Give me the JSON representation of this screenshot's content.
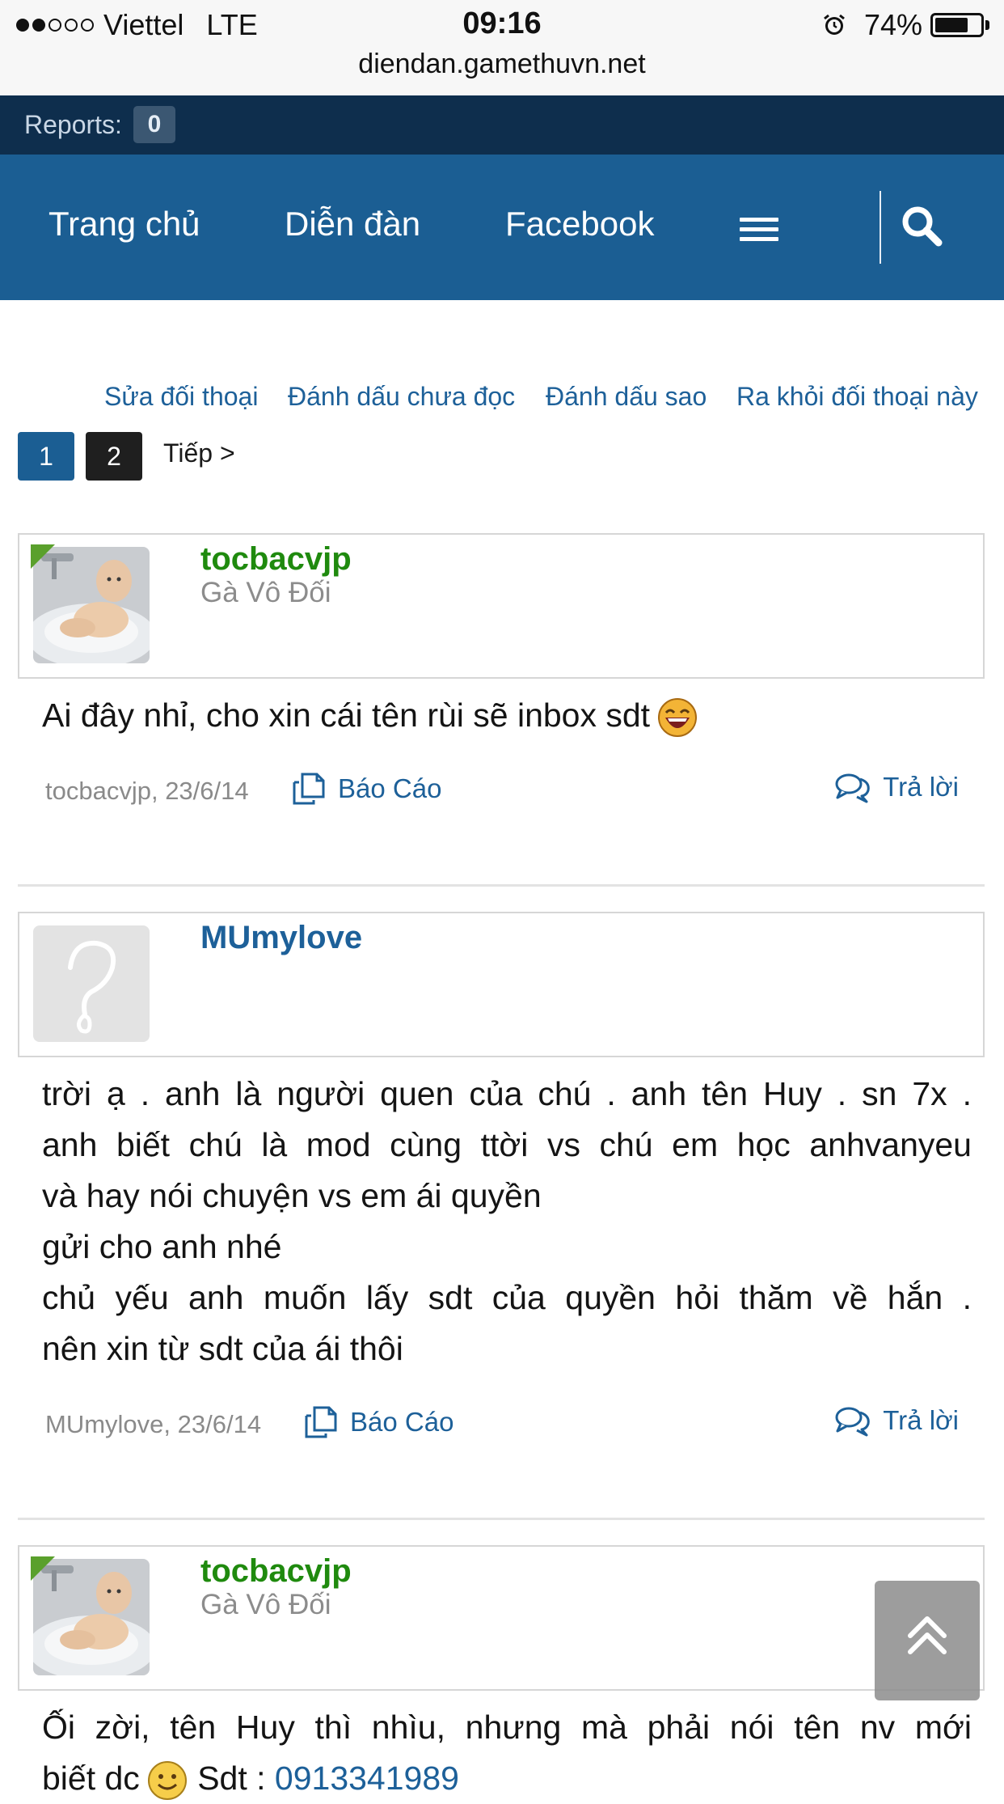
{
  "status_bar": {
    "carrier": "Viettel",
    "network": "LTE",
    "time": "09:16",
    "battery": "74%",
    "battery_level": 0.74,
    "url": "diendan.gamethuvn.net"
  },
  "reports": {
    "label": "Reports:",
    "count": "0"
  },
  "nav": {
    "items": [
      "Trang chủ",
      "Diễn đàn",
      "Facebook"
    ],
    "menu_icon": "hamburger-icon",
    "search_icon": "search-icon"
  },
  "actions": [
    "Sửa đối thoại",
    "Đánh dấu chưa đọc",
    "Đánh dấu sao",
    "Ra khỏi đối thoại này"
  ],
  "pagination": {
    "pages": [
      "1",
      "2"
    ],
    "current": "1",
    "next": "Tiếp >"
  },
  "posts": [
    {
      "username": "tocbacvjp",
      "user_title": "Gà Vô Đối",
      "online": true,
      "message_lines": [
        "Ai đây nhỉ, cho xin cái tên rùi sẽ inbox sdt"
      ],
      "smiley": "laughing-smiley-icon",
      "meta": "tocbacvjp, 23/6/14",
      "report": "Báo Cáo",
      "reply": "Trả lời"
    },
    {
      "username": "MUmylove",
      "user_title": "",
      "online": false,
      "message_lines": [
        "trời ạ . anh là người quen của chú . anh tên Huy . sn 7x .",
        "anh biết chú là mod cùng ttời vs chú em học anhvanyeu",
        "và hay nói chuyện vs em ái quyền",
        "gửi cho anh nhé",
        "chủ yếu anh muốn lấy sdt của quyền hỏi thăm về hắn .",
        "nên xin từ sdt của ái thôi"
      ],
      "meta": "MUmylove, 23/6/14",
      "report": "Báo Cáo",
      "reply": "Trả lời"
    },
    {
      "username": "tocbacvjp",
      "user_title": "Gà Vô Đối",
      "online": true,
      "message_lines": [
        "Ối zời, tên Huy thì nhìu, nhưng mà phải nói tên nv mới"
      ],
      "message_tail_before": "biết dc",
      "smiley": "smile-smiley-icon",
      "message_tail_after": " Sdt : ",
      "phone": "0913341989"
    }
  ],
  "scroll_top_icon": "double-chevron-up-icon"
}
